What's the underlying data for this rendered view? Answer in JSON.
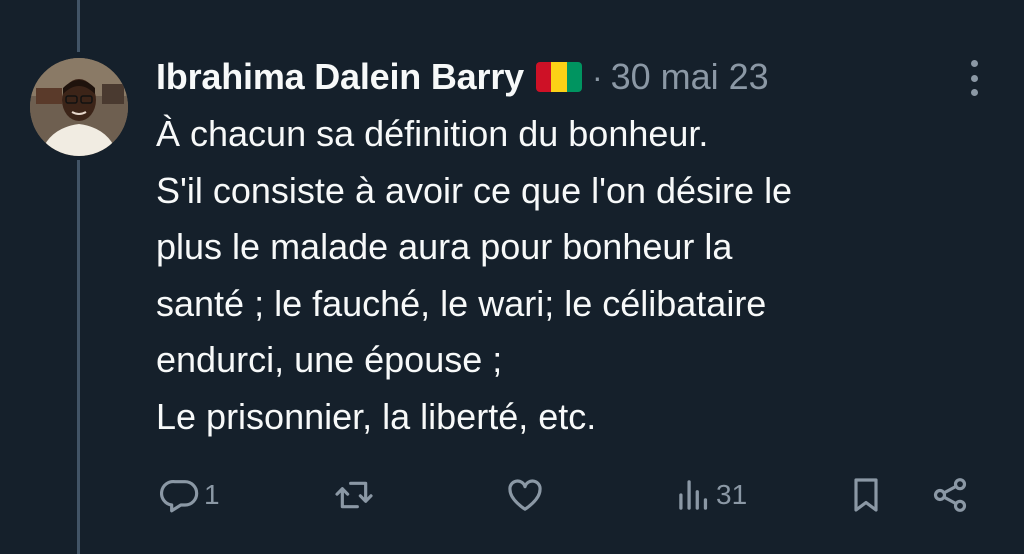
{
  "tweet": {
    "author": "Ibrahima Dalein Barry",
    "separator": "·",
    "date": "30 mai 23",
    "lines": [
      "À chacun sa définition du bonheur.",
      "S'il consiste à avoir ce que l'on désire le",
      "plus le malade aura pour bonheur la",
      "santé ; le fauché, le wari; le célibataire",
      "endurci, une épouse ;",
      "Le prisonnier, la liberté, etc."
    ]
  },
  "flag_colors": [
    "#ce1126",
    "#fcd116",
    "#009460"
  ],
  "actions": {
    "reply_count": "1",
    "retweet_count": "",
    "like_count": "",
    "views_count": "31"
  },
  "icons": [
    "reply-icon",
    "retweet-icon",
    "like-icon",
    "views-icon",
    "bookmark-icon",
    "share-icon",
    "more-icon"
  ],
  "colors": {
    "background": "#15202b",
    "text": "#f7f9f9",
    "muted": "#8b98a5",
    "thread_line": "#425466"
  }
}
